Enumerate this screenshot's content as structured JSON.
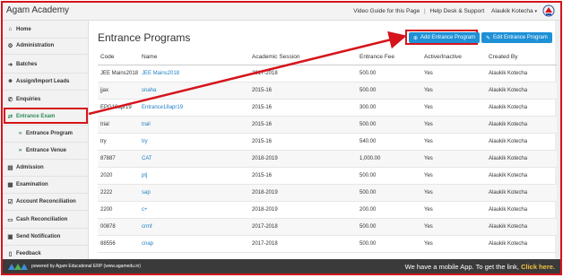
{
  "header": {
    "app_title": "Agam Academy",
    "video_guide": "Video Guide for this Page",
    "help_desk": "Help Desk & Support",
    "user_name": "Alaukik Kotecha"
  },
  "sidebar": {
    "items": [
      {
        "label": "Home",
        "icon": "home-icon",
        "glyph": "⌂"
      },
      {
        "label": "Administration",
        "icon": "gear-icon",
        "glyph": "⚙"
      },
      {
        "label": "Batches",
        "icon": "sign-in-icon",
        "glyph": "➜"
      },
      {
        "label": "Assign/Import Leads",
        "icon": "user-icon",
        "glyph": "☻"
      },
      {
        "label": "Enquiries",
        "icon": "phone-icon",
        "glyph": "✆"
      },
      {
        "label": "Entrance Exam",
        "icon": "exchange-icon",
        "glyph": "⇄"
      },
      {
        "label": "Entrance Program",
        "icon": "double-chevron-icon",
        "glyph": "»"
      },
      {
        "label": "Entrance Venue",
        "icon": "double-chevron-icon",
        "glyph": "»"
      },
      {
        "label": "Admission",
        "icon": "book-icon",
        "glyph": "▤"
      },
      {
        "label": "Examination",
        "icon": "chart-icon",
        "glyph": "▦"
      },
      {
        "label": "Account Reconciliation",
        "icon": "check-square-icon",
        "glyph": "☑"
      },
      {
        "label": "Cash Reconciliation",
        "icon": "money-icon",
        "glyph": "▭"
      },
      {
        "label": "Send Notification",
        "icon": "notification-icon",
        "glyph": "▣"
      },
      {
        "label": "Feedback",
        "icon": "file-icon",
        "glyph": "▯"
      }
    ]
  },
  "main": {
    "title": "Entrance Programs",
    "add_button": "Add Entrance Program",
    "edit_button": "Edit Entrance Program",
    "columns": [
      "Code",
      "Name",
      "Academic Session",
      "Entrance Fee",
      "Active/Inactive",
      "Created By"
    ],
    "rows": [
      [
        "JEE Mains2018",
        "JEE Mains2018",
        "2017-2018",
        "500.00",
        "Yes",
        "Alaukik Kotecha"
      ],
      [
        "jjax",
        "snaha",
        "2015-16",
        "500.00",
        "Yes",
        "Alaukik Kotecha"
      ],
      [
        "EPG18apr19",
        "Entrance18apr19",
        "2015-16",
        "300.00",
        "Yes",
        "Alaukik Kotecha"
      ],
      [
        "trial",
        "trail",
        "2015-16",
        "500.00",
        "Yes",
        "Alaukik Kotecha"
      ],
      [
        "try",
        "try",
        "2015-16",
        "540.00",
        "Yes",
        "Alaukik Kotecha"
      ],
      [
        "87887",
        "CAT",
        "2018-2019",
        "1,000.00",
        "Yes",
        "Alaukik Kotecha"
      ],
      [
        "2020",
        "ptj",
        "2015-16",
        "500.00",
        "Yes",
        "Alaukik Kotecha"
      ],
      [
        "2222",
        "sap",
        "2018-2019",
        "500.00",
        "Yes",
        "Alaukik Kotecha"
      ],
      [
        "2200",
        "c+",
        "2018-2019",
        "200.00",
        "Yes",
        "Alaukik Kotecha"
      ],
      [
        "00878",
        "crmf",
        "2017-2018",
        "500.00",
        "Yes",
        "Alaukik Kotecha"
      ],
      [
        "88556",
        "cnap",
        "2017-2018",
        "500.00",
        "Yes",
        "Alaukik Kotecha"
      ]
    ]
  },
  "footer": {
    "powered_by": "powered by Agam Educational ERP (www.agamedu.in)",
    "promo_text": "We have a mobile App. To get the link,",
    "promo_link": "Click here."
  },
  "colors": {
    "accent": "#1e90d6",
    "annotation": "#d6141c",
    "active_menu": "#2e8b57",
    "footer_bg": "#3a3a3a"
  }
}
